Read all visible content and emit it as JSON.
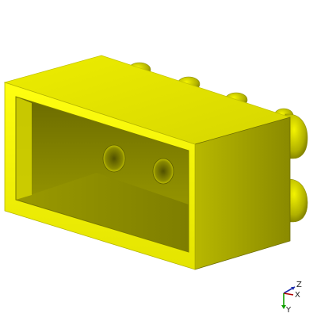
{
  "viewport": {
    "model": "lego-brick-2x4-3d-model",
    "background": "#ffffff",
    "colors": {
      "base": "#ffff00",
      "light": "#eded00",
      "mid": "#d6d600",
      "shade": "#a6a600",
      "dark": "#6f6f00",
      "edge": "#3a3a00"
    }
  },
  "triad": {
    "z_label": "Z",
    "x_label": "X",
    "y_label": "Y",
    "colors": {
      "z": "#1f2fb0",
      "x": "#b00000",
      "y": "#10a000"
    }
  }
}
